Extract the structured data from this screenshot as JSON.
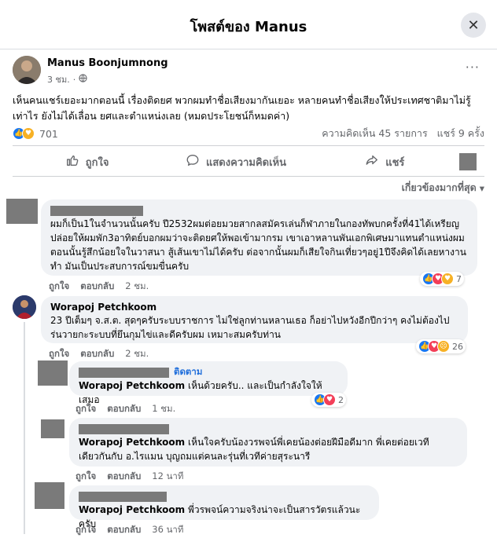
{
  "header": {
    "title": "โพสต์ของ Manus",
    "close_icon": "close-icon"
  },
  "post": {
    "author": "Manus Boonjumnong",
    "time": "3 ชม.",
    "privacy_icon": "globe-icon",
    "more": "···",
    "text": "เห็นคนแชร์เยอะมากตอนนี้ เรื่องติดยศ พวกผมทำชื่อเสียงมากันเยอะ หลายคนทำชื่อเสียงให้ประเทศชาติมาไม่รู้เท่าไร ยังไม่ได้เลื่อน ยศและตำแหน่งเลย (หมดประโยชน์ก็หมดค่า)",
    "reactions_count": "701",
    "comments_count": "ความคิดเห็น 45 รายการ",
    "shares_count": "แชร์ 9 ครั้ง"
  },
  "actions": {
    "like": "ถูกใจ",
    "comment": "แสดงความคิดเห็น",
    "share": "แชร์"
  },
  "sort_label": "เกี่ยวข้องมากที่สุด",
  "comments": [
    {
      "name": "",
      "text": "ผมก็เป็น1ในจำนวนนั้นครับ ปี2532ผมต่อยมวยสากลสมัครเล่นก็ฬาภายในกองทัพบกครั้งที่41ได้เหรียญปล่อยให้ผมพัก3อาทิตย์บอกผมว่าจะติดยศให้พอเข้ามากรม เขาเอาหลานพันเอกพิเศษมาแทนตำแหน่งผม ตอนนั้นรู้สึกน้อยใจในวาสนา สู้เส้นเขาไม่ได้ครับ ต่อจากนั้นผมก็เสียใจกินเที่ยวๆอยู่1ปีจึงคิดได้เลยหางานทำ มันเป็นประสบการณ์ขมขื่นครับ",
      "like": "ถูกใจ",
      "reply": "ตอบกลับ",
      "time": "2 ชม.",
      "reaction_count": "7"
    },
    {
      "name": "Worapoj Petchkoom",
      "text": "23 ปีเต็มๆ จ.ส.ต. สุดๆครับระบบราชการ ไม่ใช่ลูกท่านหลานเธอ ก็อย่าไปหวังอีกปีกว่าๆ คงไม่ต้องไปร่นวายกะระบบที่ยึนกุมไข่และดีครับผม เหมาะสมครับท่าน",
      "like": "ถูกใจ",
      "reply": "ตอบกลับ",
      "time": "2 ชม.",
      "reaction_count": "26"
    },
    {
      "name": "",
      "follow": "ติดตาม",
      "mention": "Worapoj Petchkoom",
      "text": " เห็นด้วยครับ.. และเป็นกำลังใจให้เสมอ",
      "like": "ถูกใจ",
      "reply": "ตอบกลับ",
      "time": "1 ชม.",
      "reaction_count": "2"
    },
    {
      "name": "",
      "mention": "Worapoj Petchkoom",
      "text": " เห็นใจครับน้องวรพจน์พี่เคยน้องต่อยฝีมือดีมาก พี่เคยต่อยเวทีเดียวกันกับ อ.ไรแมน บุญถมแต่คนละรุ่นที่เวทีค่ายสุระนารี",
      "like": "ถูกใจ",
      "reply": "ตอบกลับ",
      "time": "12 นาที"
    },
    {
      "name": "",
      "mention": "Worapoj Petchkoom",
      "text": " พี่วรพจน์ความจริงน่าจะเป็นสารวัตรแล้วนะครับ",
      "like": "ถูกใจ",
      "reply": "ตอบกลับ",
      "time": "36 นาที"
    }
  ]
}
